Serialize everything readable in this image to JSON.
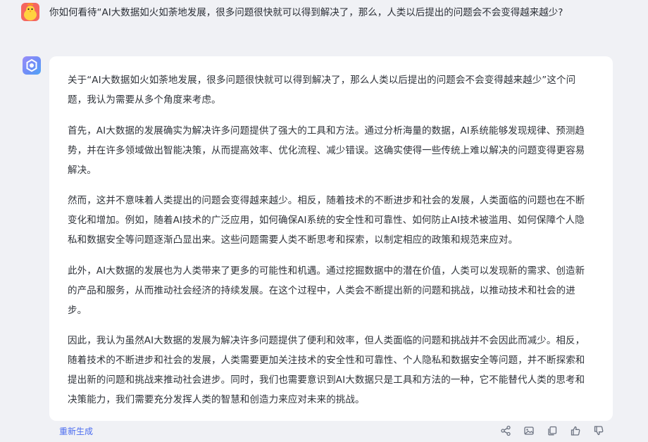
{
  "question": {
    "text": "你如何看待“AI大数据如火如荼地发展，很多问题很快就可以得到解决了，那么，人类以后提出的问题会不会变得越来越少?"
  },
  "answer": {
    "paragraphs": [
      "关于“AI大数据如火如荼地发展，很多问题很快就可以得到解决了，那么人类以后提出的问题会不会变得越来越少”这个问题，我认为需要从多个角度来考虑。",
      "首先，AI大数据的发展确实为解决许多问题提供了强大的工具和方法。通过分析海量的数据，AI系统能够发现规律、预测趋势，并在许多领域做出智能决策，从而提高效率、优化流程、减少错误。这确实使得一些传统上难以解决的问题变得更容易解决。",
      "然而，这并不意味着人类提出的问题会变得越来越少。相反，随着技术的不断进步和社会的发展，人类面临的问题也在不断变化和增加。例如，随着AI技术的广泛应用，如何确保AI系统的安全性和可靠性、如何防止AI技术被滥用、如何保障个人隐私和数据安全等问题逐渐凸显出来。这些问题需要人类不断思考和探索，以制定相应的政策和规范来应对。",
      "此外，AI大数据的发展也为人类带来了更多的可能性和机遇。通过挖掘数据中的潜在价值，人类可以发现新的需求、创造新的产品和服务，从而推动社会经济的持续发展。在这个过程中，人类会不断提出新的问题和挑战，以推动技术和社会的进步。",
      "因此，我认为虽然AI大数据的发展为解决许多问题提供了便利和效率，但人类面临的问题和挑战并不会因此而减少。相反，随着技术的不断进步和社会的发展，人类需要更加关注技术的安全性和可靠性、个人隐私和数据安全等问题，并不断探索和提出新的问题和挑战来推动社会进步。同时，我们也需要意识到AI大数据只是工具和方法的一种，它不能替代人类的思考和决策能力，我们需要充分发挥人类的智慧和创造力来应对未来的挑战。"
    ]
  },
  "footer": {
    "regenerate_label": "重新生成",
    "actions": [
      "share-icon",
      "image-icon",
      "copy-icon",
      "thumbs-up-icon",
      "thumbs-down-icon"
    ]
  },
  "colors": {
    "background": "#f0f1f5",
    "card": "#ffffff",
    "accent": "#4b6cf0",
    "user_avatar": "#f5665f"
  }
}
